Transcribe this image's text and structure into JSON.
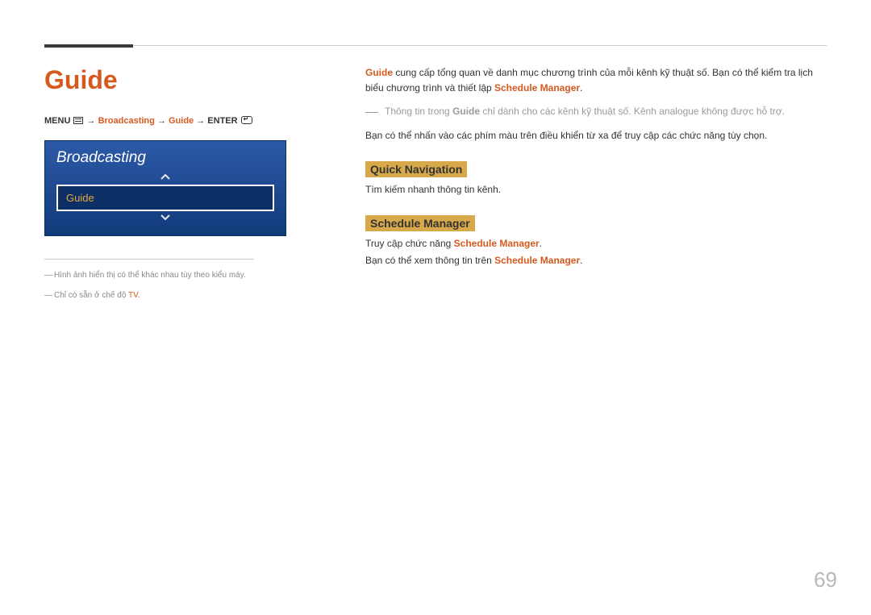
{
  "page_number": "69",
  "title": "Guide",
  "breadcrumb": {
    "menu_label": "MENU",
    "arrow": "→",
    "item1": "Broadcasting",
    "item2": "Guide",
    "enter_label": "ENTER"
  },
  "osd": {
    "title": "Broadcasting",
    "selected_item": "Guide"
  },
  "footnotes": {
    "f1_pre": "Hình ảnh hiển thị có thể khác nhau tùy theo kiểu máy.",
    "f2_pre": "Chỉ có sẵn ở chế độ ",
    "f2_hl": "TV",
    "f2_post": "."
  },
  "right": {
    "p1_hl1": "Guide",
    "p1_a": " cung cấp tổng quan về danh mục chương trình của mỗi kênh kỹ thuật số. Bạn có thể kiểm tra lịch biểu chương trình và thiết lập ",
    "p1_hl2": "Schedule Manager",
    "p1_b": ".",
    "note_a": "Thông tin trong ",
    "note_hl": "Guide",
    "note_b": " chỉ dành cho các kênh kỹ thuật số. Kênh analogue không được hỗ trợ.",
    "p2": "Bạn có thể nhấn vào các phím màu trên điều khiển từ xa để truy cập các chức năng tùy chọn.",
    "sec1_label": "Quick Navigation",
    "sec1_body": "Tìm kiếm nhanh thông tin kênh.",
    "sec2_label": "Schedule Manager",
    "sec2_line1_a": "Truy cập chức năng ",
    "sec2_line1_hl": "Schedule Manager",
    "sec2_line1_b": ".",
    "sec2_line2_a": "Bạn có thể xem thông tin trên ",
    "sec2_line2_hl": "Schedule Manager",
    "sec2_line2_b": "."
  }
}
